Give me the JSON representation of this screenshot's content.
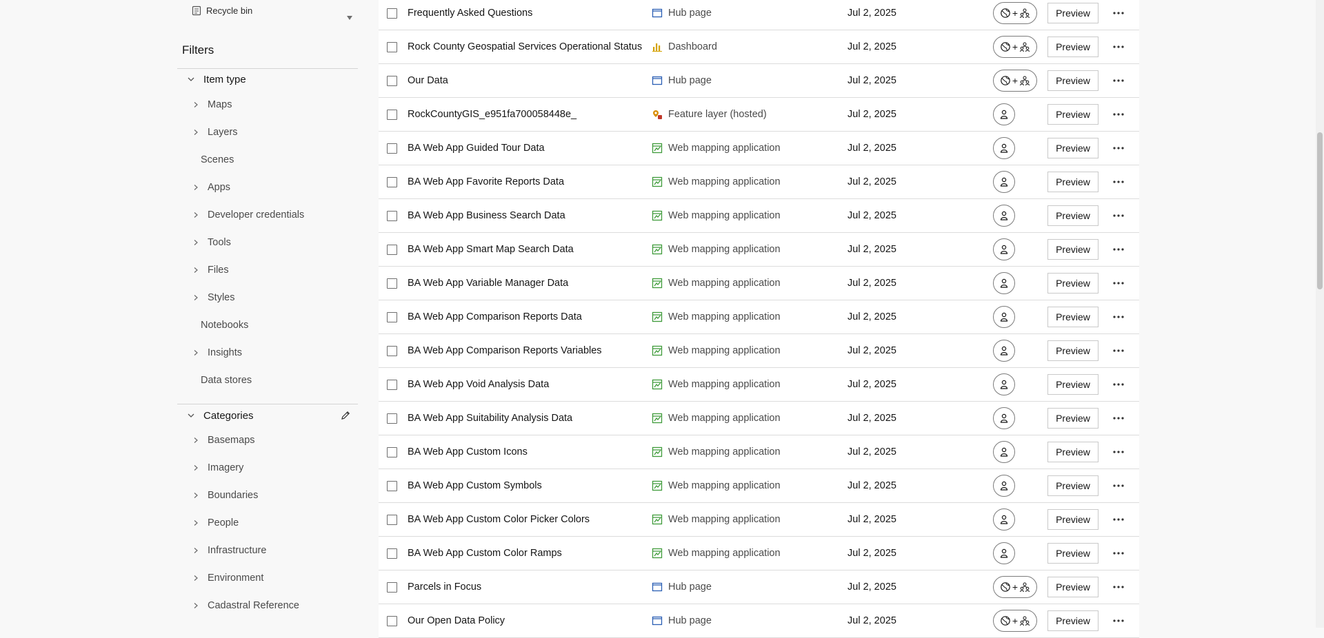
{
  "sidebar": {
    "recycle_bin": "Recycle bin",
    "filters_title": "Filters",
    "item_type": {
      "label": "Item type",
      "items": [
        {
          "label": "Maps",
          "expandable": true
        },
        {
          "label": "Layers",
          "expandable": true
        },
        {
          "label": "Scenes",
          "expandable": false
        },
        {
          "label": "Apps",
          "expandable": true
        },
        {
          "label": "Developer credentials",
          "expandable": true
        },
        {
          "label": "Tools",
          "expandable": true
        },
        {
          "label": "Files",
          "expandable": true
        },
        {
          "label": "Styles",
          "expandable": true
        },
        {
          "label": "Notebooks",
          "expandable": false
        },
        {
          "label": "Insights",
          "expandable": true
        },
        {
          "label": "Data stores",
          "expandable": false
        }
      ]
    },
    "categories": {
      "label": "Categories",
      "items": [
        {
          "label": "Basemaps"
        },
        {
          "label": "Imagery"
        },
        {
          "label": "Boundaries"
        },
        {
          "label": "People"
        },
        {
          "label": "Infrastructure"
        },
        {
          "label": "Environment"
        },
        {
          "label": "Cadastral Reference"
        }
      ]
    }
  },
  "table": {
    "preview_label": "Preview",
    "rows": [
      {
        "title": "Frequently Asked Questions",
        "type": "Hub page",
        "icon": "hub-page-icon",
        "date": "Jul 2, 2025",
        "sharing": "multi"
      },
      {
        "title": "Rock County Geospatial Services Operational Status",
        "type": "Dashboard",
        "icon": "dashboard-icon",
        "date": "Jul 2, 2025",
        "sharing": "multi"
      },
      {
        "title": "Our Data",
        "type": "Hub page",
        "icon": "hub-page-icon",
        "date": "Jul 2, 2025",
        "sharing": "multi"
      },
      {
        "title": "RockCountyGIS_e951fa700058448e_",
        "type": "Feature layer (hosted)",
        "icon": "feature-layer-icon",
        "date": "Jul 2, 2025",
        "sharing": "single"
      },
      {
        "title": "BA Web App Guided Tour Data",
        "type": "Web mapping application",
        "icon": "web-app-icon",
        "date": "Jul 2, 2025",
        "sharing": "single"
      },
      {
        "title": "BA Web App Favorite Reports Data",
        "type": "Web mapping application",
        "icon": "web-app-icon",
        "date": "Jul 2, 2025",
        "sharing": "single"
      },
      {
        "title": "BA Web App Business Search Data",
        "type": "Web mapping application",
        "icon": "web-app-icon",
        "date": "Jul 2, 2025",
        "sharing": "single"
      },
      {
        "title": "BA Web App Smart Map Search Data",
        "type": "Web mapping application",
        "icon": "web-app-icon",
        "date": "Jul 2, 2025",
        "sharing": "single"
      },
      {
        "title": "BA Web App Variable Manager Data",
        "type": "Web mapping application",
        "icon": "web-app-icon",
        "date": "Jul 2, 2025",
        "sharing": "single"
      },
      {
        "title": "BA Web App Comparison Reports Data",
        "type": "Web mapping application",
        "icon": "web-app-icon",
        "date": "Jul 2, 2025",
        "sharing": "single"
      },
      {
        "title": "BA Web App Comparison Reports Variables",
        "type": "Web mapping application",
        "icon": "web-app-icon",
        "date": "Jul 2, 2025",
        "sharing": "single"
      },
      {
        "title": "BA Web App Void Analysis Data",
        "type": "Web mapping application",
        "icon": "web-app-icon",
        "date": "Jul 2, 2025",
        "sharing": "single"
      },
      {
        "title": "BA Web App Suitability Analysis Data",
        "type": "Web mapping application",
        "icon": "web-app-icon",
        "date": "Jul 2, 2025",
        "sharing": "single"
      },
      {
        "title": "BA Web App Custom Icons",
        "type": "Web mapping application",
        "icon": "web-app-icon",
        "date": "Jul 2, 2025",
        "sharing": "single"
      },
      {
        "title": "BA Web App Custom Symbols",
        "type": "Web mapping application",
        "icon": "web-app-icon",
        "date": "Jul 2, 2025",
        "sharing": "single"
      },
      {
        "title": "BA Web App Custom Color Picker Colors",
        "type": "Web mapping application",
        "icon": "web-app-icon",
        "date": "Jul 2, 2025",
        "sharing": "single"
      },
      {
        "title": "BA Web App Custom Color Ramps",
        "type": "Web mapping application",
        "icon": "web-app-icon",
        "date": "Jul 2, 2025",
        "sharing": "single"
      },
      {
        "title": "Parcels in Focus",
        "type": "Hub page",
        "icon": "hub-page-icon",
        "date": "Jul 2, 2025",
        "sharing": "multi"
      },
      {
        "title": "Our Open Data Policy",
        "type": "Hub page",
        "icon": "hub-page-icon",
        "date": "Jul 2, 2025",
        "sharing": "multi"
      }
    ]
  },
  "colors": {
    "hub_page_icon": "#2b5fb4",
    "dashboard_icon": "#d4a300",
    "web_app_icon": "#3f9b3a",
    "feature_layer_icon": "#d98e04"
  }
}
